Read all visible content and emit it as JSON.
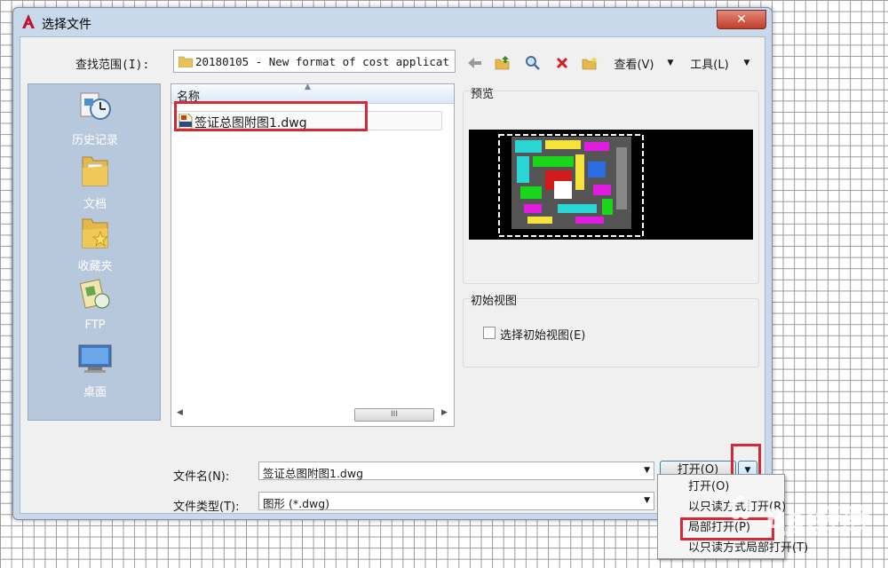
{
  "window": {
    "title": "选择文件",
    "close_symbol": "✕"
  },
  "toolbar": {
    "lookin_label": "查找范围(I):",
    "lookin_value": "20180105 - New format of cost applicat",
    "view_label": "查看(V)",
    "tools_label": "工具(L)",
    "back_icon": "back-arrow-icon",
    "up_icon": "up-folder-icon",
    "search_icon": "search-web-icon",
    "delete_icon": "delete-icon",
    "new_folder_icon": "new-folder-icon"
  },
  "places": [
    {
      "label": "历史记录",
      "icon": "history-icon"
    },
    {
      "label": "文档",
      "icon": "documents-folder-icon"
    },
    {
      "label": "收藏夹",
      "icon": "favorites-folder-icon"
    },
    {
      "label": "FTP",
      "icon": "ftp-icon"
    },
    {
      "label": "桌面",
      "icon": "desktop-icon"
    }
  ],
  "filelist": {
    "column_name": "名称",
    "files": [
      {
        "name": "签证总图附图1.dwg",
        "icon": "dwg-file-icon"
      }
    ],
    "scroll_left": "◀",
    "scroll_right": "▶",
    "scroll_thumb": "III"
  },
  "preview": {
    "title": "预览"
  },
  "initial_view": {
    "title": "初始视图",
    "checkbox_label": "选择初始视图(E)",
    "checked": false
  },
  "filename": {
    "label": "文件名(N):",
    "value": "签证总图附图1.dwg"
  },
  "filetype": {
    "label": "文件类型(T):",
    "value": "图形 (*.dwg)"
  },
  "buttons": {
    "open": "打开(O)",
    "split_arrow": "▼"
  },
  "open_menu": {
    "items": [
      "打开(O)",
      "以只读方式打开(R)",
      "局部打开(P)",
      "以只读方式局部打开(T)"
    ],
    "highlighted_index": 2
  },
  "watermark": {
    "main": "Bai经验",
    "sub": "jingyan.baidu.com"
  },
  "colors": {
    "highlight_red": "#d42a37",
    "title_bar": "#c9d9ec",
    "places_panel": "#b7c8dc",
    "close_button": "#c43c2a"
  }
}
